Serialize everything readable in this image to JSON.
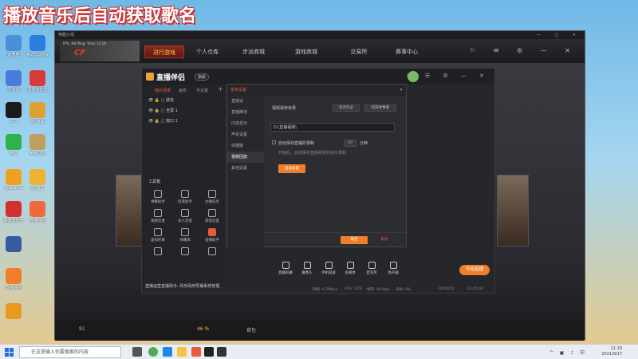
{
  "overlay": {
    "title": "播放音乐后自动获取歌名"
  },
  "desktop": {
    "icons": [
      {
        "label": "此电脑",
        "color": "#4a90d9"
      },
      {
        "label": "腾讯QQ游戏",
        "color": "#2d7de0"
      },
      {
        "label": "回收站",
        "color": "#4a7bd9"
      },
      {
        "label": "网易云音乐",
        "color": "#d9393a"
      },
      {
        "label": "QQ",
        "color": "#1a1a1a"
      },
      {
        "label": "QQ飞车",
        "color": "#e0a030"
      },
      {
        "label": "微信",
        "color": "#2fb24a"
      },
      {
        "label": "英雄联盟",
        "color": "#c0a060"
      },
      {
        "label": "WeGame",
        "color": "#f0a020"
      },
      {
        "label": "QQ飞车",
        "color": "#f0b030"
      },
      {
        "label": "网易云音乐",
        "color": "#d32f2f"
      },
      {
        "label": "直播伴侣",
        "color": "#ee6a3a"
      },
      {
        "label": "",
        "color": "#3a5aa0"
      },
      {
        "label": "直播伴侣",
        "color": "#f07e2b"
      },
      {
        "label": "",
        "color": "#e89a20"
      }
    ]
  },
  "game": {
    "window_title": "穿越火线",
    "stats": {
      "fps": "FPS: 360",
      "ping": "Ping:",
      "time": "Time: 11:19"
    },
    "logo": "CF",
    "nav": [
      "进行游戏",
      "个人仓库",
      "步派商城",
      "游戏商城",
      "交易所",
      "赛事中心"
    ],
    "active_nav": "进行游戏",
    "bottom": {
      "count": "91",
      "volume": "46 %",
      "label": "背包"
    }
  },
  "app": {
    "name": "直播伴侣",
    "badge": "旗舰",
    "scene_tabs": [
      "我的场景",
      "画布",
      "可设置"
    ],
    "scenes": [
      "歌名",
      "全屏 1",
      "窗口 1"
    ],
    "tools_title": "工具箱",
    "tools": [
      {
        "label": "弹幕助手",
        "hot": false
      },
      {
        "label": "房管助手",
        "hot": false
      },
      {
        "label": "主播任务",
        "hot": false
      },
      {
        "label": "视频连麦",
        "hot": false
      },
      {
        "label": "多人连麦",
        "hot": false
      },
      {
        "label": "游戏连麦",
        "hot": false
      },
      {
        "label": "虚拟形象",
        "hot": false
      },
      {
        "label": "弹幕库",
        "hot": false
      },
      {
        "label": "直播助手",
        "hot": true
      },
      {
        "label": "",
        "hot": false
      },
      {
        "label": "",
        "hot": false
      },
      {
        "label": "",
        "hot": false
      }
    ],
    "notice": "直播运营直播助手: 政务政府导播系统管理",
    "bottom_buttons": [
      "直播屏幕",
      "摄像头",
      "手机投屏",
      "多媒体",
      "麦克风",
      "扬声器"
    ],
    "live_button": "开始直播",
    "status": {
      "left": "网络: 0.7Mbps",
      "cpu": "CPU: 12%",
      "fps": "帧率: 60.0fps",
      "drop": "丢帧: 0%",
      "rec": "00:00:01",
      "time": "01:05:02"
    }
  },
  "dialog": {
    "title": "系统设置",
    "menu": [
      "直播设",
      "直播推流",
      "内容显示",
      "声音设置",
      "快捷键",
      "视频回放",
      "其他设置"
    ],
    "active_menu": "视频回放",
    "save_label": "视频保存目录",
    "btn_change": "更改目录",
    "btn_open": "打开文件夹",
    "input_value": "D:\\直播视频\\",
    "auto_label": "自动保存直播的录制",
    "auto_value": "10",
    "auto_unit": "分钟",
    "hint": "开始后，自动保存直播视频并提示录制",
    "highlight_btn": "自动设置",
    "ok": "确定",
    "cancel": "取消"
  },
  "taskbar": {
    "search_placeholder": "在这里输入你要搜索的内容",
    "time": "11:19",
    "date": "2021/9/17"
  }
}
